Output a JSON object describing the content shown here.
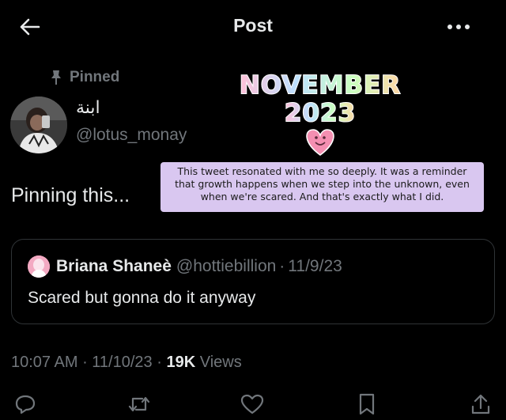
{
  "header": {
    "title": "Post",
    "back_icon": "arrow-left-icon",
    "more_icon": "more-horizontal-icon"
  },
  "post": {
    "pinned_label": "Pinned",
    "author": {
      "display_name": "ابنة",
      "handle": "@lotus_monay"
    },
    "text": "Pinning this...",
    "timestamp": "10:07 AM",
    "date": "11/10/23",
    "views_count": "19K",
    "views_label": "Views"
  },
  "quote": {
    "name": "Briana Shaneè",
    "handle": "@hottiebillion",
    "date": "11/9/23",
    "text": "Scared but gonna do it anyway"
  },
  "overlay": {
    "month": "NOVEMBER",
    "year": "2023",
    "note": "This tweet resonated with me so deeply. It was a reminder that growth happens when we step into the unknown, even when we're scared. And that's exactly what I did."
  },
  "colors": {
    "background": "#000000",
    "text_primary": "#e7e9ea",
    "text_secondary": "#71767b",
    "border": "#2f3336",
    "note_bg": "#d9c7f0",
    "heart": "#f48fb1"
  },
  "actions": [
    {
      "icon": "reply-icon"
    },
    {
      "icon": "retweet-icon"
    },
    {
      "icon": "like-icon"
    },
    {
      "icon": "bookmark-icon"
    },
    {
      "icon": "share-icon"
    }
  ]
}
